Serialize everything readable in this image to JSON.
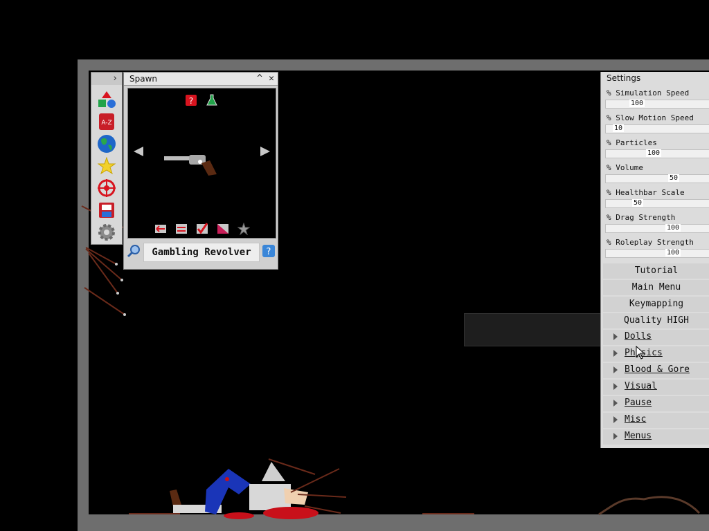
{
  "spawn_panel": {
    "title": "Spawn",
    "selected_item": "Gambling Revolver"
  },
  "settings": {
    "title": "Settings",
    "sliders": [
      {
        "label": "% Simulation Speed",
        "value": "100"
      },
      {
        "label": "% Slow Motion Speed",
        "value": "10"
      },
      {
        "label": "% Particles",
        "value": "100"
      },
      {
        "label": "% Volume",
        "value": "50"
      },
      {
        "label": "% Healthbar Scale",
        "value": "50"
      },
      {
        "label": "% Drag Strength",
        "value": "100"
      },
      {
        "label": "% Roleplay Strength",
        "value": "100"
      }
    ],
    "buttons": [
      "Tutorial",
      "Main Menu",
      "Keymapping",
      "Quality HIGH"
    ],
    "categories": [
      "Dolls",
      "Physics",
      "Blood & Gore",
      "Visual",
      "Pause",
      "Misc",
      "Menus"
    ]
  },
  "toolbar": {
    "tools": [
      "shapes-icon",
      "a-z-icon",
      "globe-icon",
      "star-icon",
      "target-icon",
      "save-icon",
      "gear-icon"
    ]
  },
  "colors": {
    "background": "#000000",
    "frame": "#6e6e6e",
    "panel": "#dcdcdc",
    "blood": "#c8101a",
    "doll_blue": "#1a35b8"
  }
}
